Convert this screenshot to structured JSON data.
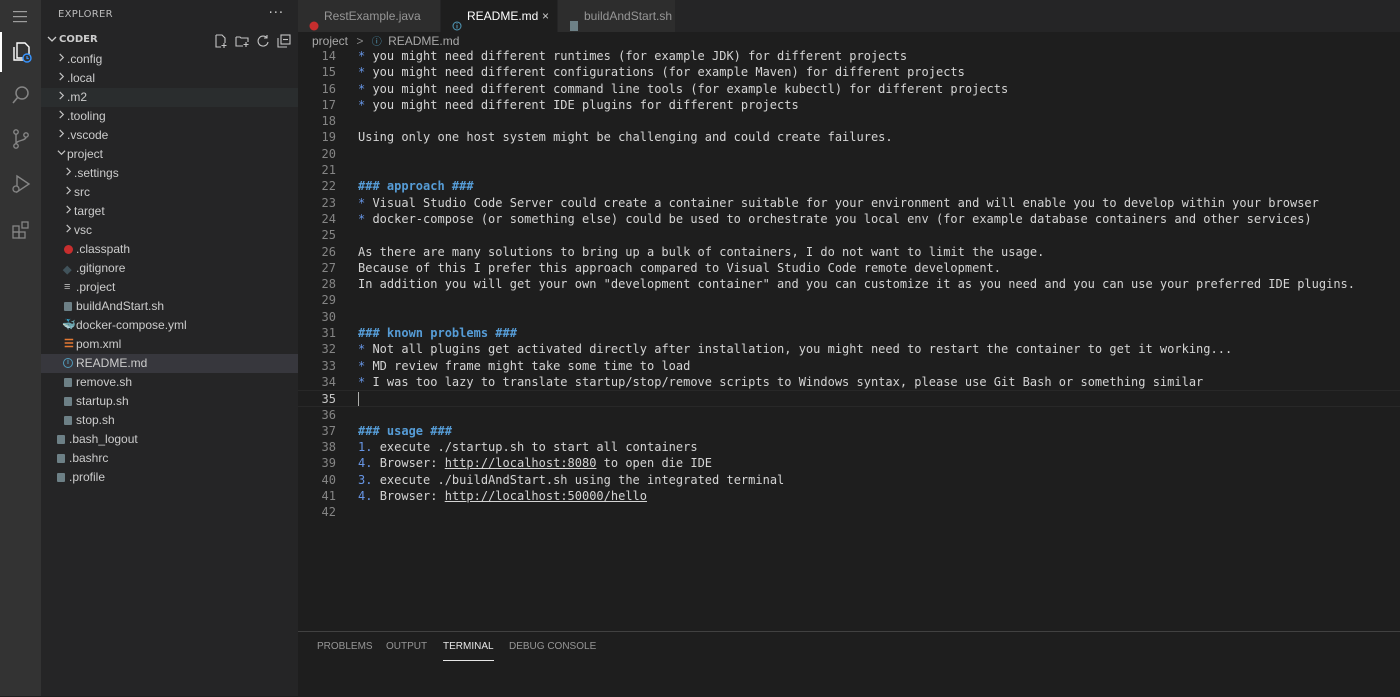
{
  "activity_bar": {
    "items": [
      {
        "name": "explorer-icon",
        "active": true
      },
      {
        "name": "search-icon",
        "active": false
      },
      {
        "name": "source-control-icon",
        "active": false
      },
      {
        "name": "run-debug-icon",
        "active": false
      },
      {
        "name": "extensions-icon",
        "active": false
      }
    ],
    "menu_icon": "hamburger-icon"
  },
  "sidebar": {
    "title": "EXPLORER",
    "more": "···",
    "section": "CODER",
    "section_actions": [
      "new-file-icon",
      "new-folder-icon",
      "refresh-icon",
      "collapse-all-icon"
    ],
    "tree": [
      {
        "label": ".config",
        "type": "folder",
        "depth": 1,
        "expanded": false
      },
      {
        "label": ".local",
        "type": "folder",
        "depth": 1,
        "expanded": false
      },
      {
        "label": ".m2",
        "type": "folder",
        "depth": 1,
        "expanded": false,
        "hover": true
      },
      {
        "label": ".tooling",
        "type": "folder",
        "depth": 1,
        "expanded": false
      },
      {
        "label": ".vscode",
        "type": "folder",
        "depth": 1,
        "expanded": false
      },
      {
        "label": "project",
        "type": "folder",
        "depth": 1,
        "expanded": true
      },
      {
        "label": ".settings",
        "type": "folder",
        "depth": 2,
        "expanded": false
      },
      {
        "label": "src",
        "type": "folder",
        "depth": 2,
        "expanded": false
      },
      {
        "label": "target",
        "type": "folder",
        "depth": 2,
        "expanded": false
      },
      {
        "label": "vsc",
        "type": "folder",
        "depth": 2,
        "expanded": false
      },
      {
        "label": ".classpath",
        "type": "file",
        "icon": "java",
        "depth": 2
      },
      {
        "label": ".gitignore",
        "type": "file",
        "icon": "git",
        "depth": 2
      },
      {
        "label": ".project",
        "type": "file",
        "icon": "lines",
        "depth": 2
      },
      {
        "label": "buildAndStart.sh",
        "type": "file",
        "icon": "generic",
        "depth": 2
      },
      {
        "label": "docker-compose.yml",
        "type": "file",
        "icon": "docker",
        "depth": 2
      },
      {
        "label": "pom.xml",
        "type": "file",
        "icon": "xml",
        "depth": 2
      },
      {
        "label": "README.md",
        "type": "file",
        "icon": "info",
        "depth": 2,
        "selected": true
      },
      {
        "label": "remove.sh",
        "type": "file",
        "icon": "generic",
        "depth": 2
      },
      {
        "label": "startup.sh",
        "type": "file",
        "icon": "generic",
        "depth": 2
      },
      {
        "label": "stop.sh",
        "type": "file",
        "icon": "generic",
        "depth": 2
      },
      {
        "label": ".bash_logout",
        "type": "file",
        "icon": "generic",
        "depth": 1
      },
      {
        "label": ".bashrc",
        "type": "file",
        "icon": "generic",
        "depth": 1
      },
      {
        "label": ".profile",
        "type": "file",
        "icon": "generic",
        "depth": 1
      }
    ]
  },
  "tabs": [
    {
      "label": "RestExample.java",
      "icon": "java",
      "active": false
    },
    {
      "label": "README.md",
      "icon": "info",
      "active": true,
      "close": "×"
    },
    {
      "label": "buildAndStart.sh",
      "icon": "generic",
      "active": false
    }
  ],
  "breadcrumb": {
    "folder": "project",
    "separator": ">",
    "file": "README.md"
  },
  "editor": {
    "current_line": 35,
    "lines": [
      {
        "n": "14",
        "segs": [
          {
            "t": "* ",
            "c": "bul"
          },
          {
            "t": "you might need different runtimes (for example JDK) for different projects"
          }
        ]
      },
      {
        "n": "15",
        "segs": [
          {
            "t": "* ",
            "c": "bul"
          },
          {
            "t": "you might need different configurations (for example Maven) for different projects"
          }
        ]
      },
      {
        "n": "16",
        "segs": [
          {
            "t": "* ",
            "c": "bul"
          },
          {
            "t": "you might need different command line tools (for example kubectl) for different projects"
          }
        ]
      },
      {
        "n": "17",
        "segs": [
          {
            "t": "* ",
            "c": "bul"
          },
          {
            "t": "you might need different IDE plugins for different projects"
          }
        ]
      },
      {
        "n": "18",
        "segs": []
      },
      {
        "n": "19",
        "segs": [
          {
            "t": "Using only one host system might be challenging and could create failures."
          }
        ]
      },
      {
        "n": "20",
        "segs": []
      },
      {
        "n": "21",
        "segs": []
      },
      {
        "n": "22",
        "segs": [
          {
            "t": "### approach ###",
            "c": "h"
          }
        ]
      },
      {
        "n": "23",
        "segs": [
          {
            "t": "* ",
            "c": "bul"
          },
          {
            "t": "Visual Studio Code Server could create a container suitable for your environment and will enable you to develop within your browser"
          }
        ]
      },
      {
        "n": "24",
        "segs": [
          {
            "t": "* ",
            "c": "bul"
          },
          {
            "t": "docker-compose (or something else) could be used to orchestrate you local env (for example database containers and other services)"
          }
        ]
      },
      {
        "n": "25",
        "segs": []
      },
      {
        "n": "26",
        "segs": [
          {
            "t": "As there are many solutions to bring up a bulk of containers, I do not want to limit the usage."
          }
        ]
      },
      {
        "n": "27",
        "segs": [
          {
            "t": "Because of this I prefer this approach compared to Visual Studio Code remote development."
          }
        ]
      },
      {
        "n": "28",
        "segs": [
          {
            "t": "In addition you will get your own \"development container\" and you can customize it as you need and you can use your preferred IDE plugins."
          }
        ]
      },
      {
        "n": "29",
        "segs": []
      },
      {
        "n": "30",
        "segs": []
      },
      {
        "n": "31",
        "segs": [
          {
            "t": "### known problems ###",
            "c": "h"
          }
        ]
      },
      {
        "n": "32",
        "segs": [
          {
            "t": "* ",
            "c": "bul"
          },
          {
            "t": "Not all plugins get activated directly after installation, you might need to restart the container to get it working..."
          }
        ]
      },
      {
        "n": "33",
        "segs": [
          {
            "t": "* ",
            "c": "bul"
          },
          {
            "t": "MD review frame might take some time to load"
          }
        ]
      },
      {
        "n": "34",
        "segs": [
          {
            "t": "* ",
            "c": "bul"
          },
          {
            "t": "I was too lazy to translate startup/stop/remove scripts to Windows syntax, please use Git Bash or something similar"
          }
        ]
      },
      {
        "n": "35",
        "segs": []
      },
      {
        "n": "36",
        "segs": []
      },
      {
        "n": "37",
        "segs": [
          {
            "t": "### usage ###",
            "c": "h"
          }
        ]
      },
      {
        "n": "38",
        "segs": [
          {
            "t": "1. ",
            "c": "bul"
          },
          {
            "t": "execute ./startup.sh to start all containers"
          }
        ]
      },
      {
        "n": "39",
        "segs": [
          {
            "t": "4. ",
            "c": "bul"
          },
          {
            "t": "Browser: "
          },
          {
            "t": "http://localhost:8080",
            "c": "link"
          },
          {
            "t": " to open die IDE"
          }
        ]
      },
      {
        "n": "40",
        "segs": [
          {
            "t": "3. ",
            "c": "bul"
          },
          {
            "t": "execute ./buildAndStart.sh using the integrated terminal"
          }
        ]
      },
      {
        "n": "41",
        "segs": [
          {
            "t": "4. ",
            "c": "bul"
          },
          {
            "t": "Browser: "
          },
          {
            "t": "http://localhost:50000/hello",
            "c": "link"
          }
        ]
      },
      {
        "n": "42",
        "segs": []
      }
    ]
  },
  "panel": {
    "tabs": [
      {
        "label": "PROBLEMS",
        "active": false
      },
      {
        "label": "OUTPUT",
        "active": false
      },
      {
        "label": "TERMINAL",
        "active": true
      },
      {
        "label": "DEBUG CONSOLE",
        "active": false
      }
    ]
  },
  "colors": {
    "background": "#1e1e1e",
    "sidebar": "#252526",
    "activity_bar": "#333333",
    "heading": "#569cd6",
    "selection": "#37373d"
  }
}
